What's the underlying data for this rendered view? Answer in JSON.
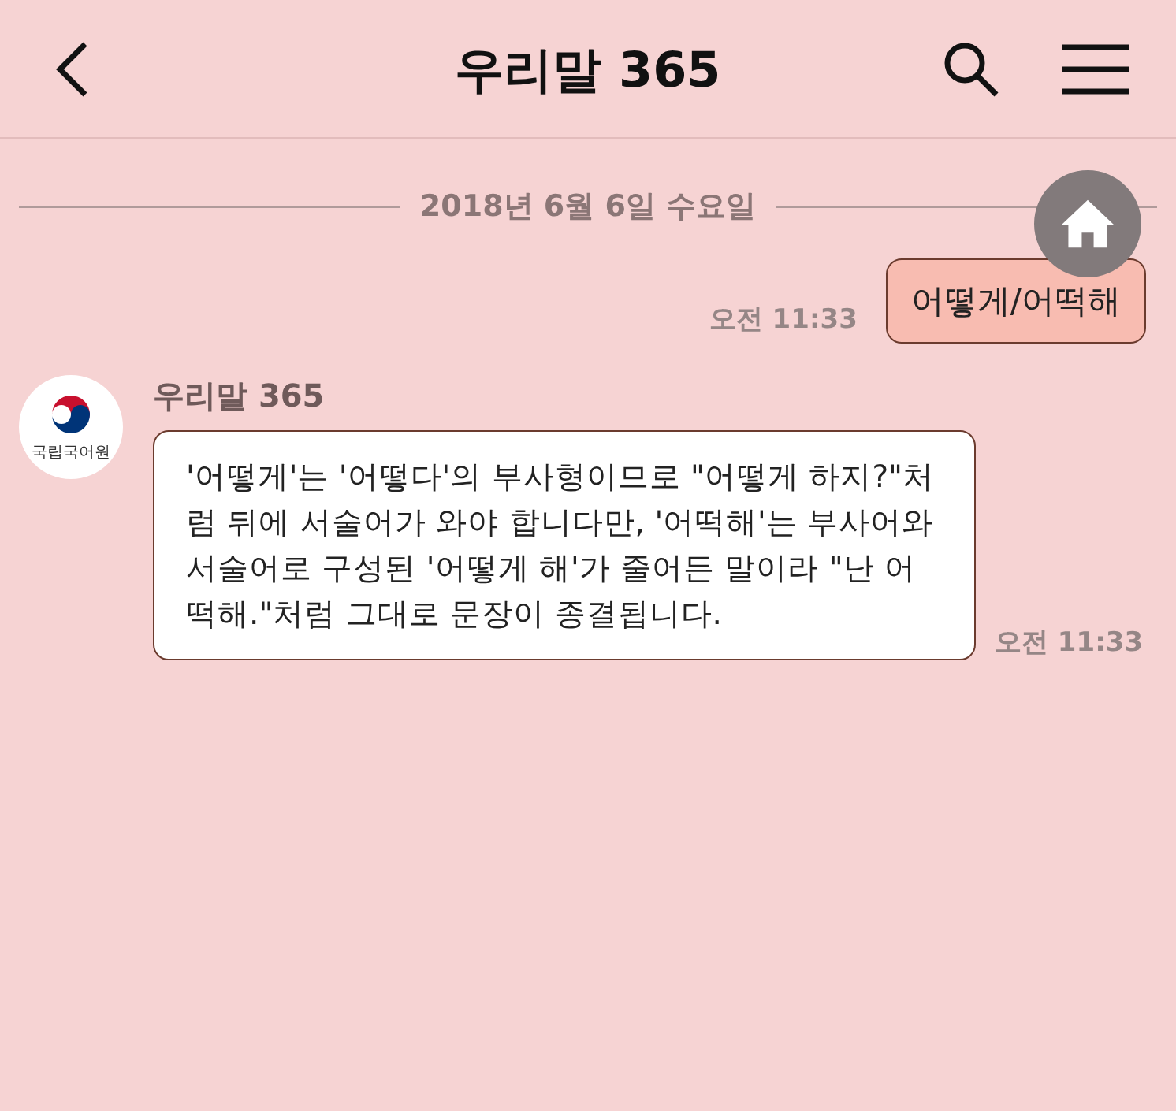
{
  "header": {
    "title": "우리말 365"
  },
  "date_divider": "2018년 6월 6일 수요일",
  "messages": [
    {
      "kind": "sent",
      "text": "어떻게/어떡해",
      "time": "오전 11:33"
    },
    {
      "kind": "received",
      "sender": "우리말 365",
      "avatar_label": "국립국어원",
      "text": "'어떻게'는 '어떻다'의 부사형이므로 \"어떻게 하지?\"처럼 뒤에 서술어가 와야 합니다만, '어떡해'는 부사어와 서술어로 구성된 '어떻게 해'가 줄어든 말이라 \"난 어떡해.\"처럼 그대로 문장이 종결됩니다.",
      "time": "오전 11:33"
    }
  ]
}
